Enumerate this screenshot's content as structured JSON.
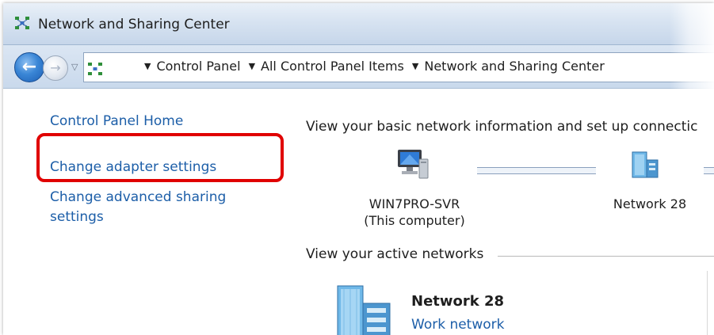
{
  "window": {
    "title": "Network and Sharing Center",
    "title_icon": "network-icon"
  },
  "navigation": {
    "back_icon": "back-arrow-icon",
    "forward_icon": "forward-arrow-icon",
    "history_icon": "dropdown-arrow-icon",
    "location_icon": "control-panel-icon",
    "breadcrumb": [
      "Control Panel",
      "All Control Panel Items",
      "Network and Sharing Center"
    ]
  },
  "sidebar": {
    "links": [
      {
        "label": "Control Panel Home"
      },
      {
        "label": "Change adapter settings"
      },
      {
        "label": "Change advanced sharing\nsettings"
      }
    ],
    "highlight_color": "#e00000"
  },
  "main": {
    "headline": "View your basic network information and set up connectic",
    "map": {
      "computer_name": "WIN7PRO-SVR",
      "computer_subtitle": "(This computer)",
      "network_name": "Network  28"
    },
    "active_section_title": "View your active networks",
    "active_network": {
      "name": "Network  28",
      "type": "Work network"
    }
  },
  "colors": {
    "link": "#1c5ea8",
    "titlebar": "#d7e3f1"
  }
}
